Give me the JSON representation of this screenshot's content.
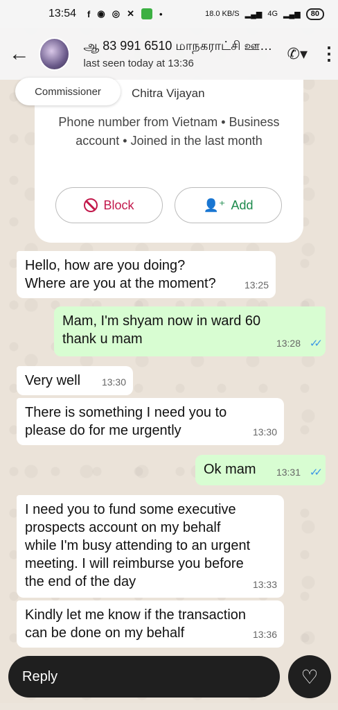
{
  "status_bar": {
    "time": "13:54",
    "net_speed": "18.0 KB/S",
    "battery": "80",
    "signal_label": "4G"
  },
  "app_bar": {
    "title": "ஆ 83 991 6510 மாநகராட்சி ஊரை மாநக...",
    "subtitle": "last seen today at 13:36"
  },
  "chip": {
    "label": "Commissioner"
  },
  "info_card": {
    "name": "Chitra Vijayan",
    "description": "Phone number from Vietnam • Business account • Joined in the last month",
    "block_label": "Block",
    "add_label": "Add"
  },
  "messages": [
    {
      "type": "incoming",
      "text": "Hello, how are you doing?\nWhere are you at the moment?",
      "time": "13:25"
    },
    {
      "type": "outgoing",
      "text": "Mam, I'm shyam now  in ward 60\nthank u mam",
      "time": "13:28"
    },
    {
      "type": "incoming",
      "text": "Very well",
      "time": "13:30"
    },
    {
      "type": "incoming",
      "text": "There is something I need you to\nplease do for me urgently",
      "time": "13:30"
    },
    {
      "type": "outgoing",
      "text": "Ok mam",
      "time": "13:31"
    },
    {
      "type": "incoming",
      "text": "I need you to fund some executive\nprospects account on my behalf\nwhile I'm busy attending to an urgent\nmeeting. I will reimburse you before\nthe end of the day",
      "time": "13:33"
    },
    {
      "type": "incoming",
      "text": "Kindly let me know if the transaction\ncan be done on my behalf",
      "time": "13:36"
    }
  ],
  "reply_bar": {
    "placeholder": "Reply"
  },
  "colors": {
    "outgoing_bubble": "#d8fdd2",
    "incoming_bubble": "#ffffff",
    "block_red": "#c2184b",
    "add_green": "#1c8a4c",
    "read_ticks": "#3b96e6"
  }
}
